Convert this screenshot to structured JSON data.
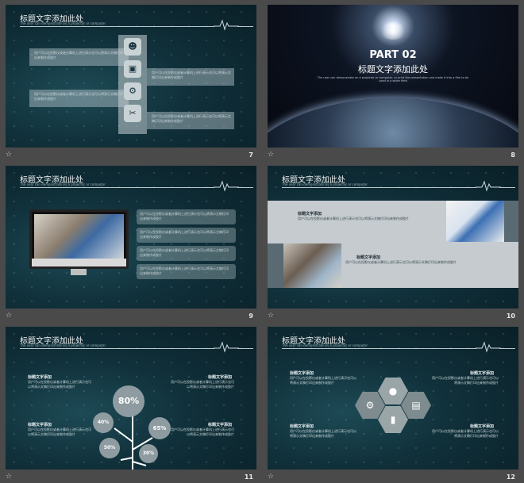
{
  "common": {
    "slide_title": "标题文字添加此处",
    "slide_subtitle": "The user can demonstrate on a projector or computer",
    "body_short": "用户可以在投影仪或者计算机上进行演示也可以将演示文稿打印出来制作成胶片",
    "heading": "标题文字添加"
  },
  "slides": [
    {
      "number": "7"
    },
    {
      "number": "8",
      "part": "PART 02",
      "title": "标题文字添加此处",
      "caption": "The user can demonstrate on a projector or computer, or print the presentation and make it into a film to be used in a wider field"
    },
    {
      "number": "9"
    },
    {
      "number": "10"
    },
    {
      "number": "11",
      "pcts": [
        "80%",
        "40%",
        "65%",
        "50%",
        "30%"
      ]
    },
    {
      "number": "12"
    }
  ],
  "icons": {
    "star": "☆",
    "s7": [
      "head-icon",
      "briefcase-icon",
      "gear-icon",
      "scissors-icon"
    ],
    "s12": [
      "gear-icon",
      "user-icon",
      "chat-icon",
      "bar-chart-icon"
    ]
  },
  "colors": {
    "accent": "#1d4a55",
    "panel": "#c5cbcf"
  }
}
